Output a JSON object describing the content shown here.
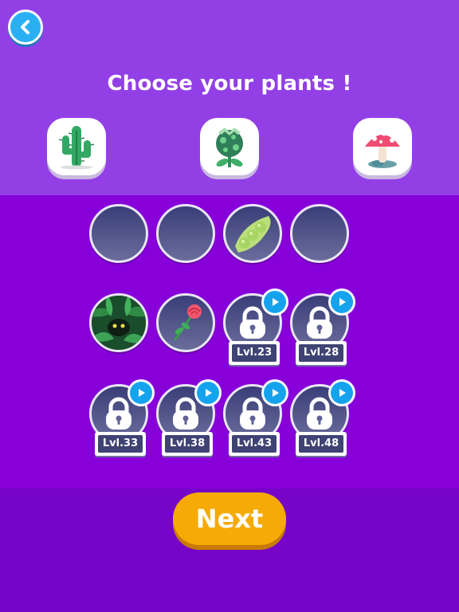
{
  "header": {
    "title": "Choose your plants !",
    "back_icon": "chevron-left-icon"
  },
  "featured_plants": [
    {
      "name": "cactus",
      "icon": "cactus-icon"
    },
    {
      "name": "pitcher-plant",
      "icon": "carnivorous-plant-icon"
    },
    {
      "name": "mushroom",
      "icon": "mushroom-icon"
    }
  ],
  "selected_slots": [
    {
      "filled": false
    },
    {
      "filled": false
    },
    {
      "filled": true,
      "icon": "pea-pod-icon"
    },
    {
      "filled": false
    }
  ],
  "plant_grid": [
    {
      "state": "unlocked",
      "icon": "jungle-creature-icon"
    },
    {
      "state": "unlocked",
      "icon": "rose-icon"
    },
    {
      "state": "locked",
      "level_label": "Lvl.23"
    },
    {
      "state": "locked",
      "level_label": "Lvl.28"
    },
    {
      "state": "locked",
      "level_label": "Lvl.33"
    },
    {
      "state": "locked",
      "level_label": "Lvl.38"
    },
    {
      "state": "locked",
      "level_label": "Lvl.43"
    },
    {
      "state": "locked",
      "level_label": "Lvl.48"
    }
  ],
  "footer": {
    "next_label": "Next"
  },
  "colors": {
    "top_bg": "#9240e6",
    "middle_bg": "#8700da",
    "bottom_bg": "#7605c7",
    "button": "#f6aa06",
    "play_badge": "#16a3ee"
  }
}
